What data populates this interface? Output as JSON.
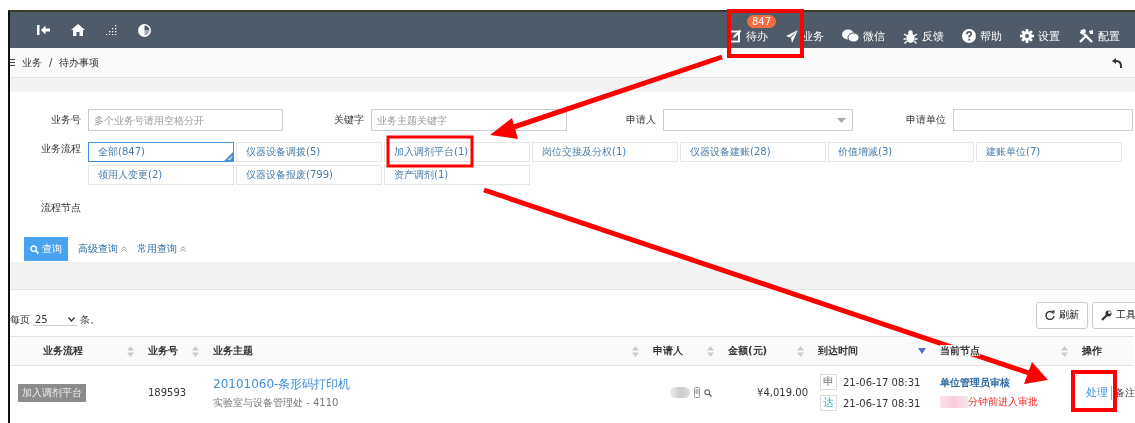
{
  "topbar": {
    "nav": [
      {
        "label": "待办",
        "badge": "847"
      },
      {
        "label": "业务"
      },
      {
        "label": "微信"
      },
      {
        "label": "反馈"
      },
      {
        "label": "帮助"
      },
      {
        "label": "设置"
      },
      {
        "label": "配置"
      }
    ]
  },
  "breadcrumb": {
    "items": [
      "业务",
      "待办事项"
    ],
    "separator": "/"
  },
  "filters": {
    "fields": [
      {
        "label": "业务号",
        "kind": "input",
        "placeholder": "多个业务号请用空格分开"
      },
      {
        "label": "关键字",
        "kind": "input",
        "placeholder": "业务主题关键字"
      },
      {
        "label": "申请人",
        "kind": "select"
      },
      {
        "label": "申请单位",
        "kind": "input"
      }
    ],
    "process": {
      "label": "业务流程",
      "options": [
        {
          "label": "全部(847)",
          "selected": true
        },
        {
          "label": "仪器设备调拨(5)",
          "selected": false
        },
        {
          "label": "加入调剂平台(1)",
          "selected": false
        },
        {
          "label": "岗位交接及分权(1)",
          "selected": false
        },
        {
          "label": "仪器设备建账(28)",
          "selected": false
        },
        {
          "label": "价值增减(3)",
          "selected": false
        },
        {
          "label": "建账单位(7)",
          "selected": false
        },
        {
          "label": "领用人变更(2)",
          "selected": false
        },
        {
          "label": "仪器设备报废(799)",
          "selected": false
        },
        {
          "label": "资产调剂(1)",
          "selected": false
        }
      ]
    },
    "node_label": "流程节点",
    "search_button": "查询",
    "links": [
      "高级查询",
      "常用查询"
    ]
  },
  "table": {
    "page_size_prefix": "每页",
    "page_size": "25",
    "page_size_suffix": "条。",
    "tools": [
      "刷新",
      "工具"
    ],
    "columns": [
      {
        "label": "业务流程",
        "sortable": true,
        "sorted_desc": false
      },
      {
        "label": "业务号",
        "sortable": true,
        "sorted_desc": false
      },
      {
        "label": "业务主题",
        "sortable": true,
        "sorted_desc": false
      },
      {
        "label": "申请人",
        "sortable": true,
        "sorted_desc": false
      },
      {
        "label": "金额(元)",
        "sortable": true,
        "sorted_desc": false
      },
      {
        "label": "到达时间",
        "sortable": true,
        "sorted_desc": true
      },
      {
        "label": "当前节点",
        "sortable": true,
        "sorted_desc": false
      },
      {
        "label": "操作",
        "sortable": false
      }
    ],
    "rows": [
      {
        "process": "加入调剂平台",
        "id": "189593",
        "title": "20101060-条形码打印机",
        "subtitle": "实验室与设备管理处 - 4110",
        "amount": "¥4,019.00",
        "times": [
          {
            "mark": "申",
            "time": "21-06-17 08:31"
          },
          {
            "mark": "达",
            "time": "21-06-17 08:31"
          }
        ],
        "node": "单位管理员审核",
        "node_note": "分钟前进入审批",
        "actions": [
          "处理",
          "备注"
        ]
      }
    ]
  }
}
